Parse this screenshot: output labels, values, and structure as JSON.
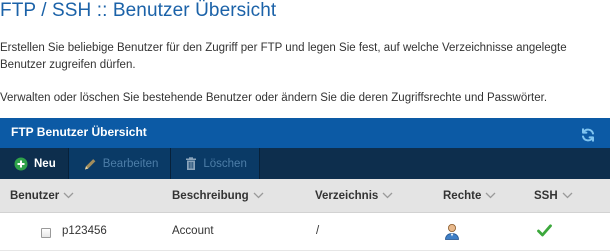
{
  "page": {
    "title": "FTP / SSH :: Benutzer Übersicht",
    "intro": "Erstellen Sie beliebige Benutzer für den Zugriff per FTP und legen Sie fest, auf welche Verzeichnisse angelegte Benutzer zugreifen dürfen.",
    "intro2": "Verwalten oder löschen Sie bestehende Benutzer oder ändern Sie die deren Zugriffsrechte und Passwörter."
  },
  "panel": {
    "title": "FTP Benutzer Übersicht",
    "refresh_icon": "refresh-icon"
  },
  "toolbar": {
    "new_label": "Neu",
    "edit_label": "Bearbeiten",
    "delete_label": "Löschen"
  },
  "table": {
    "columns": [
      "Benutzer",
      "Beschreibung",
      "Verzeichnis",
      "Rechte",
      "SSH"
    ],
    "rows": [
      {
        "user": "p123456",
        "description": "Account",
        "directory": "/",
        "rights_icon": "user-icon",
        "ssh_icon": "check-icon"
      }
    ]
  },
  "colors": {
    "accent": "#1b62a8",
    "header_bg": "#0c5aa5",
    "toolbar_bg": "#0d2e4d",
    "check_green": "#3ca83c"
  }
}
